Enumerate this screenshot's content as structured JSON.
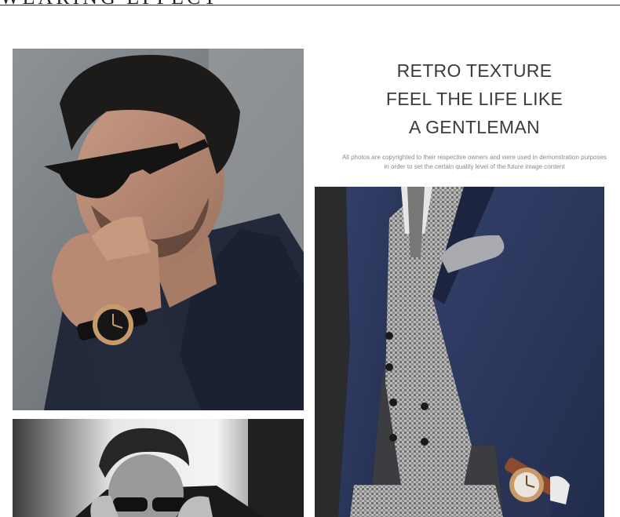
{
  "header": {
    "title": "WEARING EFFECT"
  },
  "headline": {
    "lines": [
      "RETRO TEXTURE",
      "FEEL THE LIFE LIKE",
      "A GENTLEMAN"
    ]
  },
  "disclaimer": {
    "lines": [
      "All photos are copyrighted to their respective owners and were used in  demonstration purposes",
      "in order to set the certain quality level of the future  image content"
    ]
  },
  "colors": {
    "background": "#ffffff",
    "headline_text": "#3b3b3b",
    "disclaimer_text": "#8a8a8a",
    "jacket_navy": "#2b3550",
    "watch_gold": "#c89a6a"
  }
}
